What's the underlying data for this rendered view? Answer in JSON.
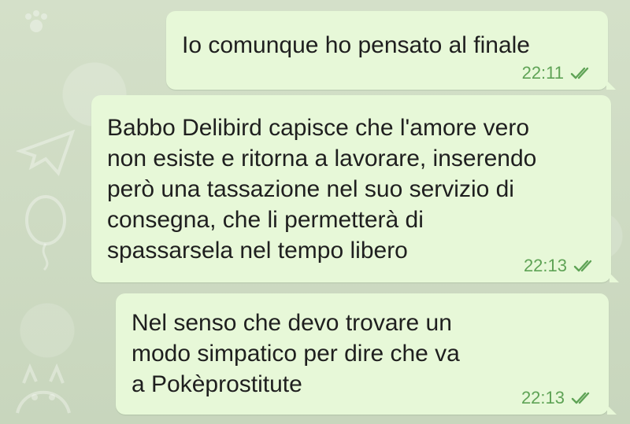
{
  "messages": [
    {
      "text": "Io comunque ho pensato al finale",
      "time": "22:11",
      "status": "read",
      "status_icon": "double-check-icon"
    },
    {
      "text": "Babbo Delibird capisce che l'amore vero non esiste e ritorna a lavorare, inserendo però una tassazione nel suo servizio di consegna, che li permetterà di spassarsela nel tempo libero",
      "time": "22:13",
      "status": "read",
      "status_icon": "double-check-icon"
    },
    {
      "text": "Nel senso che devo trovare un modo simpatico per dire che va a Pokèprostitute",
      "time": "22:13",
      "status": "read",
      "status_icon": "double-check-icon"
    }
  ],
  "colors": {
    "bubble": "#e7f8d8",
    "meta": "#5fa356",
    "background": "#cfdcc4"
  }
}
